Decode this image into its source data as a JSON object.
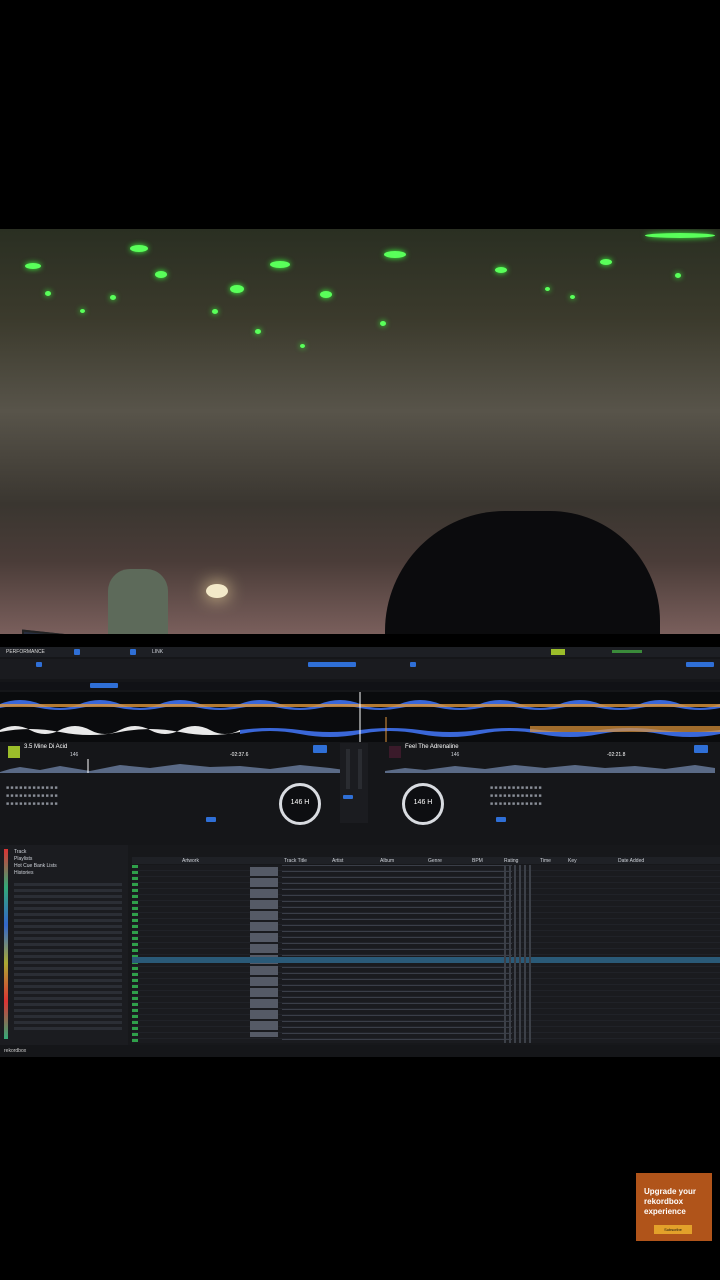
{
  "app": {
    "name": "rekordbox",
    "mode": "PERFORMANCE",
    "bottom_label": "rekordbox"
  },
  "deck1": {
    "title": "3.5 Mine Di Acid",
    "bpm": "146",
    "time": "-02:37.6",
    "key": "KEY"
  },
  "deck2": {
    "title": "Feel The Adrenaline",
    "bpm": "146",
    "time": "-02:21.8",
    "key": "KEY"
  },
  "jog1": {
    "value": "146 H"
  },
  "jog2": {
    "value": "146 H"
  },
  "link": {
    "label": "LINK"
  },
  "browser": {
    "columns": [
      "Artwork",
      "Track Title",
      "Artist",
      "Album",
      "Genre",
      "BPM",
      "Rating",
      "Time",
      "Key",
      "Date Added"
    ],
    "tree": [
      "Track",
      "Playlists",
      "Hot Cue Bank Lists",
      "Histories"
    ]
  },
  "ad": {
    "headline": "Upgrade your rekordbox experience",
    "button": "Subscribe"
  },
  "colors": {
    "accent": "#2f6fd6",
    "wave_blue": "#3a67d8",
    "wave_orange": "#e0963a",
    "ad_bg": "#b0541a"
  }
}
